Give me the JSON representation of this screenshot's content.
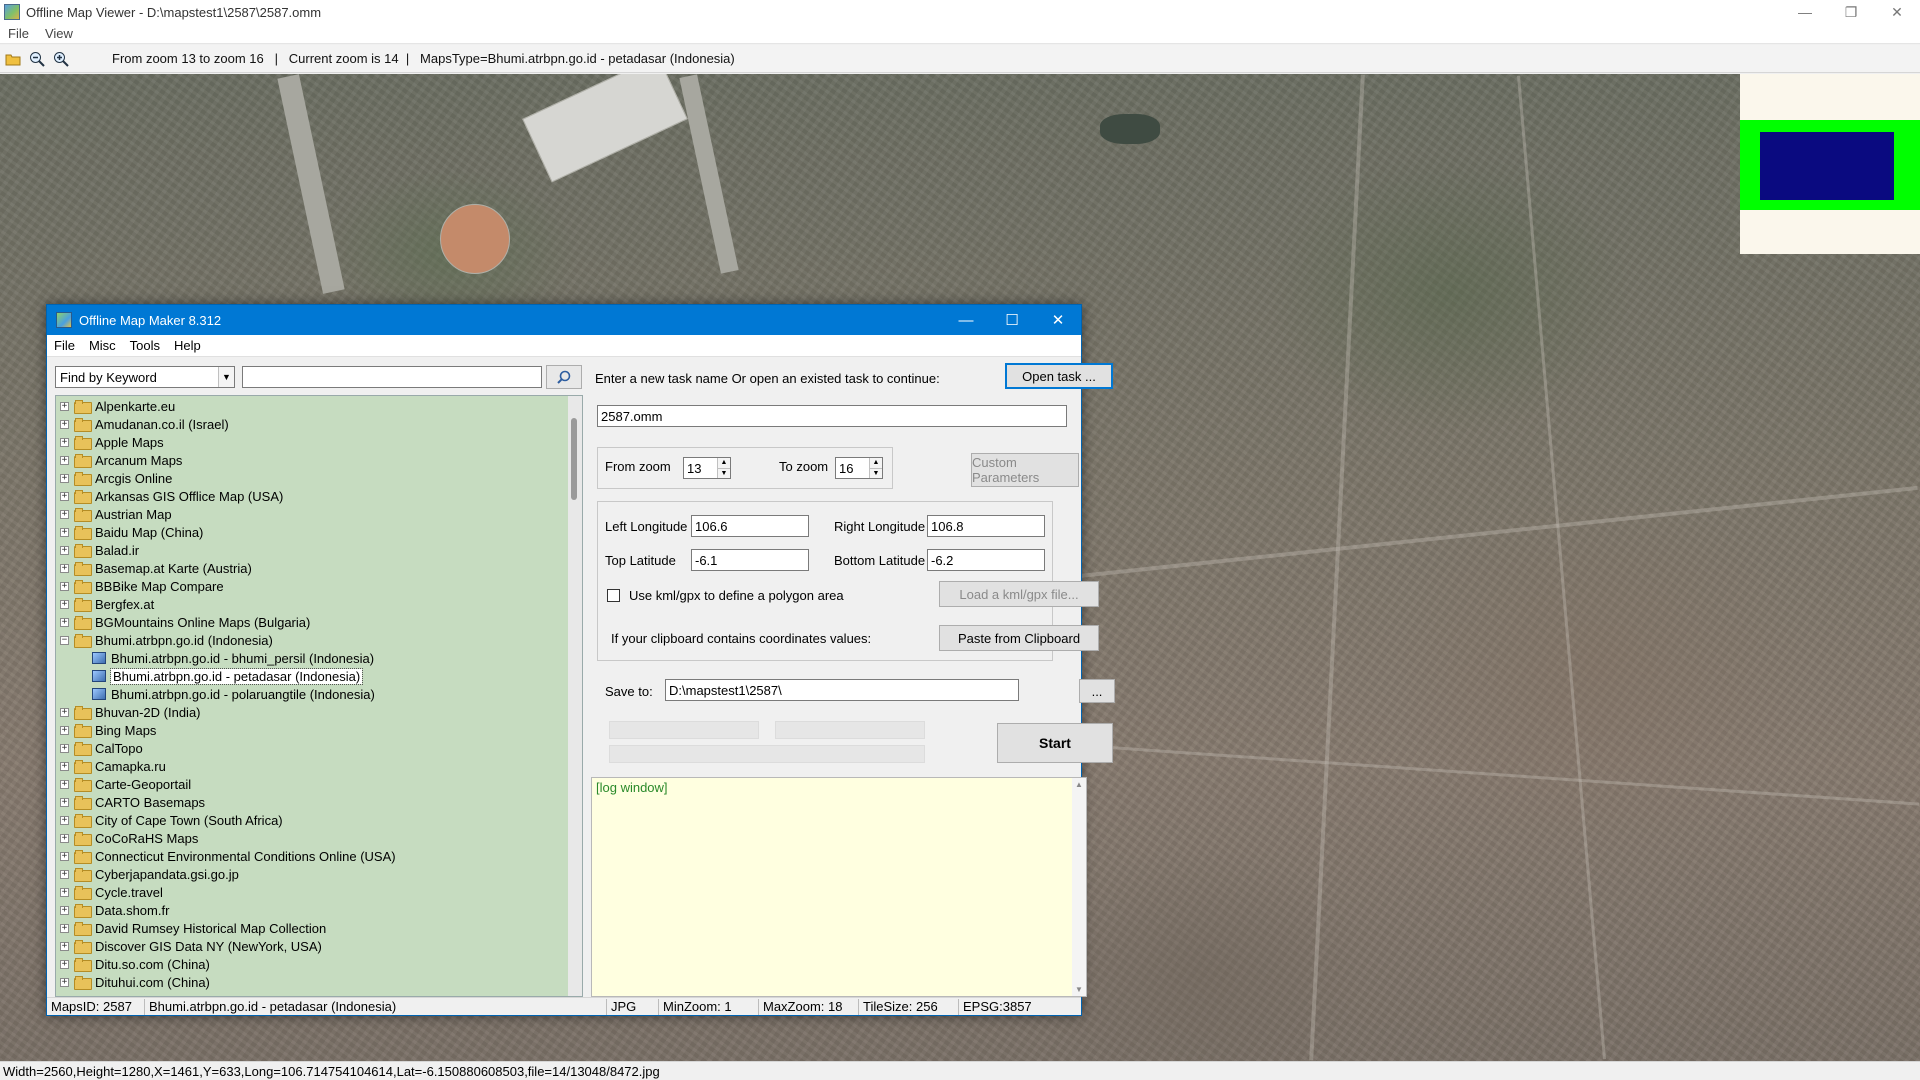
{
  "viewer": {
    "title": "Offline Map Viewer - D:\\mapstest1\\2587\\2587.omm",
    "menu": [
      "File",
      "View"
    ],
    "toolbar_status": "From zoom 13 to zoom 16   |   Current zoom is 14  |   MapsType=Bhumi.atrbpn.go.id - petadasar (Indonesia)",
    "statusbar": "Width=2560,Height=1280,X=1461,Y=633,Long=106.714754104614,Lat=-6.150880608503,file=14/13048/8472.jpg",
    "icons": [
      "open-folder-icon",
      "zoom-out-icon",
      "zoom-in-icon"
    ]
  },
  "overview_colors": {
    "frame": "#00ff00",
    "view": "#0a0a80",
    "bg": "#fbf7ec"
  },
  "dialog": {
    "title": "Offline Map Maker 8.312",
    "menu": [
      "File",
      "Misc",
      "Tools",
      "Help"
    ],
    "search": {
      "mode": "Find by Keyword",
      "value": ""
    },
    "tree": [
      {
        "label": "Alpenkarte.eu",
        "type": "folder",
        "expander": "+"
      },
      {
        "label": "Amudanan.co.il (Israel)",
        "type": "folder",
        "expander": "+"
      },
      {
        "label": "Apple Maps",
        "type": "folder",
        "expander": "+"
      },
      {
        "label": "Arcanum Maps",
        "type": "folder",
        "expander": "+"
      },
      {
        "label": "Arcgis Online",
        "type": "folder",
        "expander": "+"
      },
      {
        "label": "Arkansas GIS Offlice Map (USA)",
        "type": "folder",
        "expander": "+"
      },
      {
        "label": "Austrian Map",
        "type": "folder",
        "expander": "+"
      },
      {
        "label": "Baidu Map (China)",
        "type": "folder",
        "expander": "+"
      },
      {
        "label": "Balad.ir",
        "type": "folder",
        "expander": "+"
      },
      {
        "label": "Basemap.at Karte (Austria)",
        "type": "folder",
        "expander": "+"
      },
      {
        "label": "BBBike Map Compare",
        "type": "folder",
        "expander": "+"
      },
      {
        "label": "Bergfex.at",
        "type": "folder",
        "expander": "+"
      },
      {
        "label": "BGMountains Online Maps (Bulgaria)",
        "type": "folder",
        "expander": "+"
      },
      {
        "label": "Bhumi.atrbpn.go.id (Indonesia)",
        "type": "folder-open",
        "expander": "−"
      },
      {
        "label": "Bhumi.atrbpn.go.id - bhumi_persil (Indonesia)",
        "type": "map",
        "expander": ""
      },
      {
        "label": "Bhumi.atrbpn.go.id - petadasar (Indonesia)",
        "type": "map",
        "expander": "",
        "selected": true
      },
      {
        "label": "Bhumi.atrbpn.go.id - polaruangtile (Indonesia)",
        "type": "map",
        "expander": ""
      },
      {
        "label": "Bhuvan-2D (India)",
        "type": "folder",
        "expander": "+"
      },
      {
        "label": "Bing Maps",
        "type": "folder",
        "expander": "+"
      },
      {
        "label": "CalTopo",
        "type": "folder",
        "expander": "+"
      },
      {
        "label": "Camapka.ru",
        "type": "folder",
        "expander": "+"
      },
      {
        "label": "Carte-Geoportail",
        "type": "folder",
        "expander": "+"
      },
      {
        "label": "CARTO Basemaps",
        "type": "folder",
        "expander": "+"
      },
      {
        "label": "City of Cape Town (South Africa)",
        "type": "folder",
        "expander": "+"
      },
      {
        "label": "CoCoRaHS Maps",
        "type": "folder",
        "expander": "+"
      },
      {
        "label": "Connecticut Environmental Conditions Online (USA)",
        "type": "folder",
        "expander": "+"
      },
      {
        "label": "Cyberjapandata.gsi.go.jp",
        "type": "folder",
        "expander": "+"
      },
      {
        "label": "Cycle.travel",
        "type": "folder",
        "expander": "+"
      },
      {
        "label": "Data.shom.fr",
        "type": "folder",
        "expander": "+"
      },
      {
        "label": "David Rumsey Historical Map Collection",
        "type": "folder",
        "expander": "+"
      },
      {
        "label": "Discover GIS Data NY (NewYork, USA)",
        "type": "folder",
        "expander": "+"
      },
      {
        "label": "Ditu.so.com (China)",
        "type": "folder",
        "expander": "+"
      },
      {
        "label": "Dituhui.com (China)",
        "type": "folder",
        "expander": "+"
      }
    ],
    "task_prompt": "Enter a new task name Or open an existed task to continue:",
    "open_task_label": "Open task ...",
    "task_name": "2587.omm",
    "from_zoom_label": "From zoom",
    "from_zoom": "13",
    "to_zoom_label": "To zoom",
    "to_zoom": "16",
    "custom_params_label": "Custom Parameters",
    "left_lon_label": "Left Longitude",
    "left_lon": "106.6",
    "right_lon_label": "Right Longitude",
    "right_lon": "106.8",
    "top_lat_label": "Top Latitude",
    "top_lat": "-6.1",
    "bottom_lat_label": "Bottom Latitude",
    "bottom_lat": "-6.2",
    "kml_label": "Use kml/gpx to define a polygon area",
    "kml_checked": false,
    "load_kml_label": "Load a kml/gpx file...",
    "clipboard_label": "If your clipboard contains coordinates values:",
    "paste_label": "Paste from Clipboard",
    "save_to_label": "Save to:",
    "save_to": "D:\\mapstest1\\2587\\",
    "browse_label": "...",
    "start_label": "Start",
    "log_text": "[log window]",
    "status": {
      "maps_id": "MapsID: 2587",
      "map_name": "Bhumi.atrbpn.go.id - petadasar (Indonesia)",
      "format": "JPG",
      "min_zoom": "MinZoom: 1",
      "max_zoom": "MaxZoom: 18",
      "tile_size": "TileSize: 256",
      "epsg": "EPSG:3857"
    }
  }
}
